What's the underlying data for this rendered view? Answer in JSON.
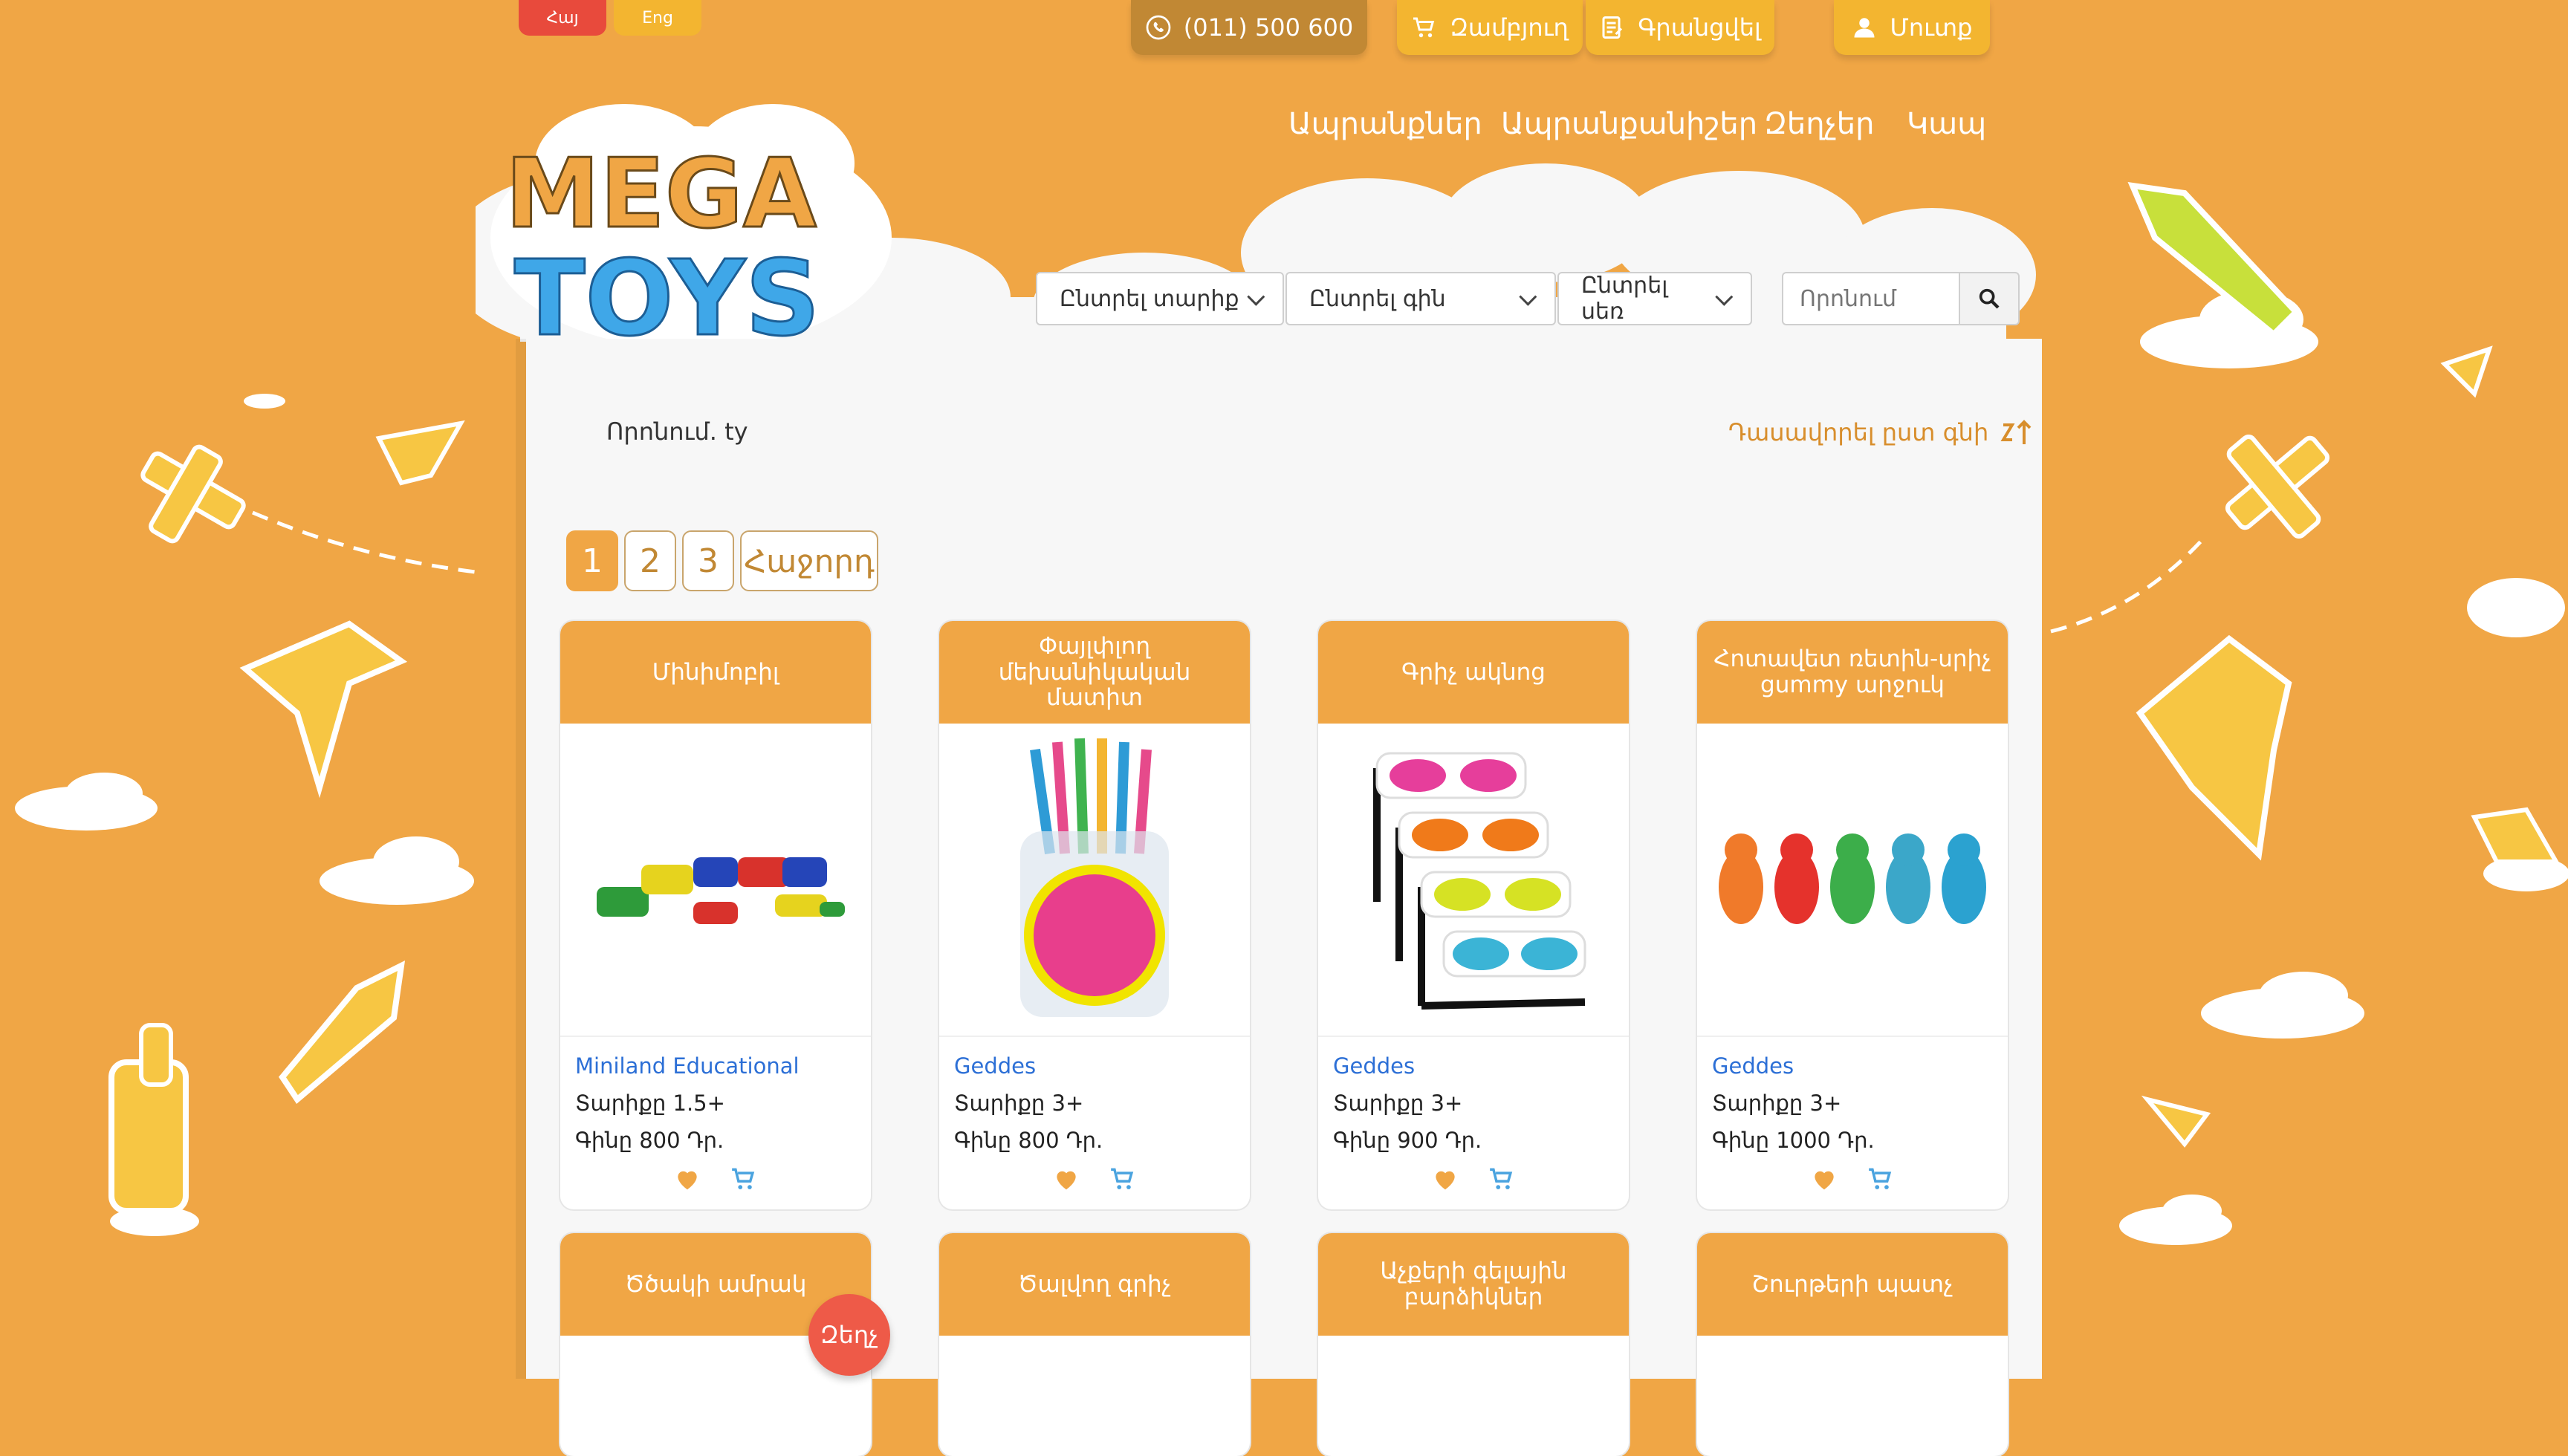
{
  "top": {
    "lang_hy": "Հայ",
    "lang_en": "Eng",
    "phone": "(011) 500 600",
    "cart": "Զամբյուղ",
    "register": "Գրանցվել",
    "login": "Մուտք"
  },
  "nav": {
    "products": "Ապրանքներ",
    "brands": "Ապրանքանիշեր",
    "discounts": "Զեղչեր",
    "contact": "Կապ"
  },
  "logo": {
    "line1": "MEGA",
    "line2": "TOYS"
  },
  "filters": {
    "age": "Ընտրել տարիք",
    "price": "Ընտրել գին",
    "color": "Ընտրել սեռ",
    "search_placeholder": "Որոնում"
  },
  "results": {
    "search_label": "Որոնում. ty",
    "sort_label": "Դասավորել ըստ գնի"
  },
  "pagination": [
    "1",
    "2",
    "3",
    "Հաջորդ"
  ],
  "products": [
    {
      "title": "Մինիմոբիլ",
      "brand": "Miniland Educational",
      "age": "Տարիքը 1.5+",
      "price": "Գինը 800 Դր."
    },
    {
      "title": "Փայլփլող մեխանիկական մատիտ",
      "brand": "Geddes",
      "age": "Տարիքը 3+",
      "price": "Գինը 800 Դր."
    },
    {
      "title": "Գրիչ ակնոց",
      "brand": "Geddes",
      "age": "Տարիքը 3+",
      "price": "Գինը 900 Դր."
    },
    {
      "title": "Հոտավետ ռետին-սրիչ gummy արջուկ",
      "brand": "Geddes",
      "age": "Տարիքը 3+",
      "price": "Գինը 1000 Դր."
    },
    {
      "title": "Ծծակի ամրակ"
    },
    {
      "title": "Ծալվող գրիչ"
    },
    {
      "title": "Աչքերի գելային բարձիկներ"
    },
    {
      "title": "Շուրթերի պատչ"
    }
  ],
  "fab": "Զեղչ",
  "colors": {
    "orange": "#F0A645",
    "yellow": "#F3B530",
    "red": "#E84A3C",
    "link": "#2C6FD6"
  }
}
